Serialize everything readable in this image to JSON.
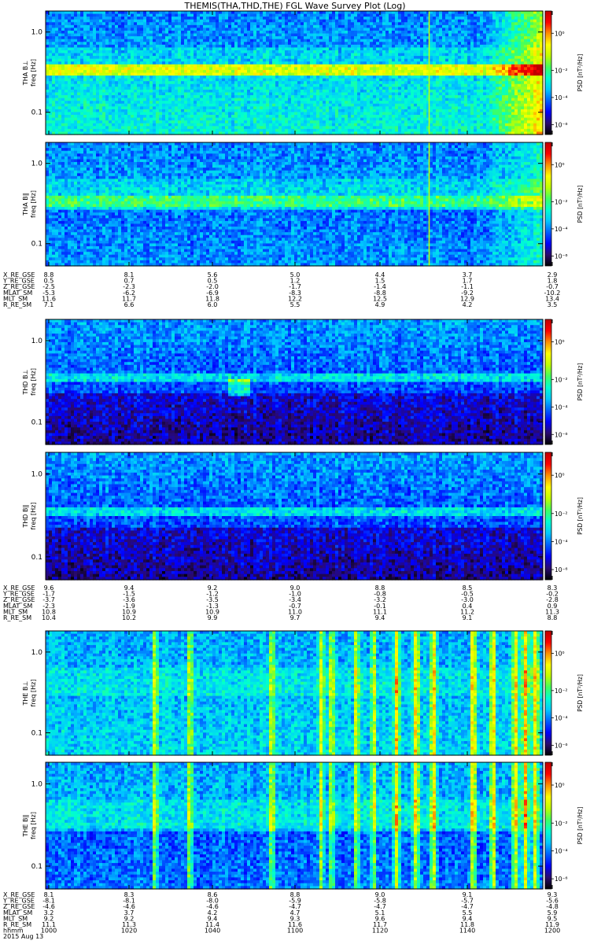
{
  "title": "THEMIS(THA,THD,THE) FGL Wave Survey Plot (Log)",
  "colorbar_label": "PSD [nT²/Hz]",
  "colorbar_ticks": [
    "10⁰",
    "10⁻²",
    "10⁻⁴",
    "10⁻⁶"
  ],
  "freq_ticks": [
    "1.0",
    "0.1"
  ],
  "groups": [
    {
      "panels": [
        {
          "probe": "THA",
          "label": "THA B⊥",
          "ylabel": "freq [Hz]",
          "event": {
            "lines": [
              540
            ]
          }
        },
        {
          "probe": "THA",
          "label": "THA B∥",
          "ylabel": "freq [Hz]",
          "event": {
            "lines": [
              540
            ]
          }
        }
      ],
      "eph_names": [
        "X_RE_GSE",
        "Y_RE_GSE",
        "Z_RE_GSE",
        "MLAT_SM",
        "MLT_SM",
        "R_RE_SM"
      ],
      "eph_cols": [
        [
          "8.8",
          "0.5",
          "-2.5",
          "-5.3",
          "11.6",
          "7.1"
        ],
        [
          "8.1",
          "0.7",
          "-2.3",
          "-6.2",
          "11.7",
          "6.6"
        ],
        [
          "5.6",
          "0.5",
          "-2.0",
          "-6.9",
          "11.8",
          "6.0"
        ],
        [
          "5.0",
          "1.2",
          "-1.7",
          "-8.3",
          "12.2",
          "5.5"
        ],
        [
          "4.4",
          "1.5",
          "-1.4",
          "-8.8",
          "12.5",
          "4.9"
        ],
        [
          "3.7",
          "1.7",
          "-1.1",
          "-9.2",
          "12.9",
          "4.2"
        ],
        [
          "2.9",
          "1.8",
          "-0.7",
          "-10.2",
          "13.4",
          "3.5"
        ]
      ]
    },
    {
      "panels": [
        {
          "probe": "THD",
          "label": "THD B⊥",
          "ylabel": "freq [Hz]",
          "event": {
            "lines": []
          }
        },
        {
          "probe": "THD",
          "label": "THD B∥",
          "ylabel": "freq [Hz]",
          "event": {
            "lines": []
          }
        }
      ],
      "eph_names": [
        "X_RE_GSE",
        "Y_RE_GSE",
        "Z_RE_GSE",
        "MLAT_SM",
        "MLT_SM",
        "R_RE_SM"
      ],
      "eph_cols": [
        [
          "9.6",
          "-1.7",
          "-3.7",
          "-2.3",
          "10.8",
          "10.4"
        ],
        [
          "9.4",
          "-1.5",
          "-3.6",
          "-1.9",
          "10.9",
          "10.2"
        ],
        [
          "9.2",
          "-1.2",
          "-3.5",
          "-1.3",
          "10.9",
          "9.9"
        ],
        [
          "9.0",
          "-1.0",
          "-3.4",
          "-0.7",
          "11.0",
          "9.7"
        ],
        [
          "8.8",
          "-0.8",
          "-3.2",
          "-0.1",
          "11.1",
          "9.4"
        ],
        [
          "8.5",
          "-0.5",
          "-3.0",
          "0.4",
          "11.2",
          "9.1"
        ],
        [
          "8.3",
          "-0.2",
          "-2.8",
          "0.9",
          "11.3",
          "8.8"
        ]
      ]
    },
    {
      "panels": [
        {
          "probe": "THE",
          "label": "THE B⊥",
          "ylabel": "freq [Hz]",
          "event": {
            "lines": []
          }
        },
        {
          "probe": "THE",
          "label": "THE B∥",
          "ylabel": "freq [Hz]",
          "event": {
            "lines": []
          }
        }
      ],
      "eph_names": [
        "X_RE_GSE",
        "Y_RE_GSE",
        "Z_RE_GSE",
        "MLAT_SM",
        "MLT_SM",
        "R_RE_SM",
        "hhmm",
        "2015 Aug 13"
      ],
      "eph_cols": [
        [
          "8.1",
          "-8.1",
          "-4.6",
          "3.2",
          "9.2",
          "11.1",
          "1000"
        ],
        [
          "8.3",
          "-8.1",
          "-4.6",
          "3.7",
          "9.2",
          "11.3",
          "1020"
        ],
        [
          "8.6",
          "-8.0",
          "-4.6",
          "4.2",
          "9.4",
          "11.4",
          "1040"
        ],
        [
          "8.8",
          "-5.9",
          "-4.7",
          "4.7",
          "9.3",
          "11.6",
          "1100"
        ],
        [
          "9.0",
          "-5.8",
          "-4.7",
          "5.1",
          "9.6",
          "11.7",
          "1120"
        ],
        [
          "9.1",
          "-5.7",
          "-4.7",
          "5.5",
          "9.4",
          "11.8",
          "1140"
        ],
        [
          "9.3",
          "-5.6",
          "-4.8",
          "5.9",
          "9.5",
          "11.9",
          "1200"
        ]
      ]
    }
  ],
  "chart_data": {
    "type": "heatmap",
    "title": "THEMIS(THA,THD,THE) FGL Wave Survey Plot (Log)",
    "x_ticks": [
      "1000",
      "1020",
      "1040",
      "1100",
      "1120",
      "1140",
      "1200"
    ],
    "x_range": [
      "1000",
      "1200"
    ],
    "y_scale": "log",
    "y_ticks": [
      1.0,
      0.1
    ],
    "z_label": "PSD [nT²/Hz]",
    "z_scale": "log",
    "z_range": [
      1e-06,
      10
    ],
    "z_ticks": [
      1,
      0.01,
      0.0001,
      1e-06
    ],
    "colormap": [
      "#000000",
      "#2a0a70",
      "#0000ff",
      "#0060ff",
      "#00c8ff",
      "#00ffd0",
      "#40ff60",
      "#c0ff00",
      "#ffff00",
      "#ff9000",
      "#ff0000",
      "#c00000"
    ],
    "panels": [
      "THA B⊥",
      "THA B∥",
      "THD B⊥",
      "THD B∥",
      "THE B⊥",
      "THE B∥"
    ],
    "notes": "Spectrogram panels; intensity rendered procedurally, not per-pixel data."
  }
}
